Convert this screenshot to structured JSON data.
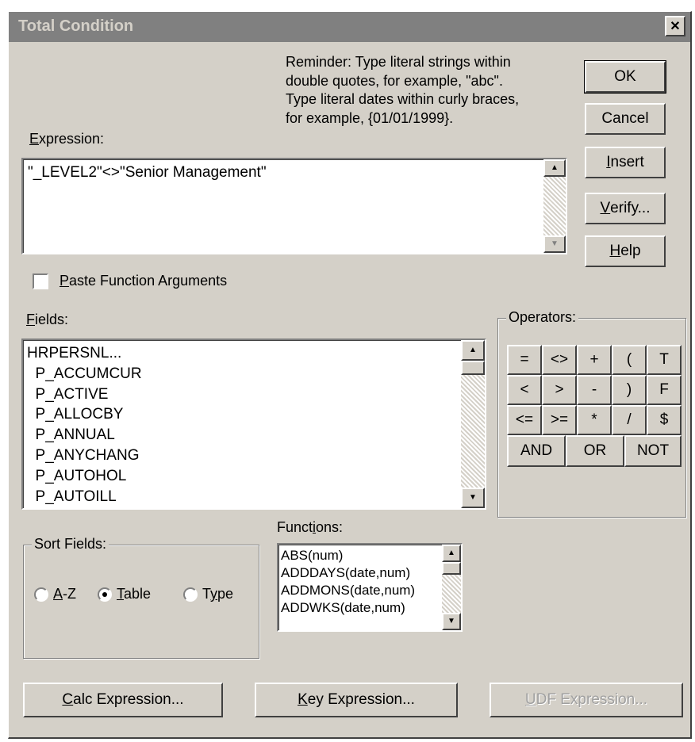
{
  "dialog": {
    "title": "Total Condition",
    "close_glyph": "✕"
  },
  "reminder": {
    "line1": "Reminder: Type literal strings within",
    "line2": "double quotes, for example, \"abc\".",
    "line3": "Type literal dates within curly braces,",
    "line4": "for example, {01/01/1999}."
  },
  "expression": {
    "label_key": "E",
    "label_rest": "xpression:",
    "value": "\"_LEVEL2\"<>\"Senior Management\""
  },
  "buttons": {
    "ok": "OK",
    "cancel": "Cancel",
    "insert_key": "I",
    "insert_rest": "nsert",
    "verify_key": "V",
    "verify_rest": "erify...",
    "help_key": "H",
    "help_rest": "elp"
  },
  "paste": {
    "key": "P",
    "rest": "aste Function Arguments",
    "checked": false
  },
  "fields": {
    "label_key": "F",
    "label_rest": "ields:",
    "items": [
      "HRPERSNL...",
      "  P_ACCUMCUR",
      "  P_ACTIVE",
      "  P_ALLOCBY",
      "  P_ANNUAL",
      "  P_ANYCHANG",
      "  P_AUTOHOL",
      "  P_AUTOILL"
    ]
  },
  "operators": {
    "label": "Operators:",
    "row1": [
      "=",
      "<>",
      "+",
      "(",
      "T"
    ],
    "row2": [
      "<",
      ">",
      "-",
      ")",
      "F"
    ],
    "row3": [
      "<=",
      ">=",
      "*",
      "/",
      "$"
    ],
    "row4": [
      "AND",
      "OR",
      "NOT"
    ]
  },
  "sort": {
    "label": "Sort Fields:",
    "az_key": "A",
    "az_rest": "-Z",
    "table_key": "T",
    "table_rest": "able",
    "type_pre": "T",
    "type_key": "y",
    "type_rest": "pe",
    "selected": "Table"
  },
  "functions": {
    "label_pre": "Funct",
    "label_key": "i",
    "label_rest": "ons:",
    "items": [
      "ABS(num)",
      "ADDDAYS(date,num)",
      "ADDMONS(date,num)",
      "ADDWKS(date,num)"
    ]
  },
  "bottom": {
    "calc_key": "C",
    "calc_rest": "alc Expression...",
    "key_key": "K",
    "key_rest": "ey Expression...",
    "udf_key": "U",
    "udf_rest": "DF Expression..."
  }
}
